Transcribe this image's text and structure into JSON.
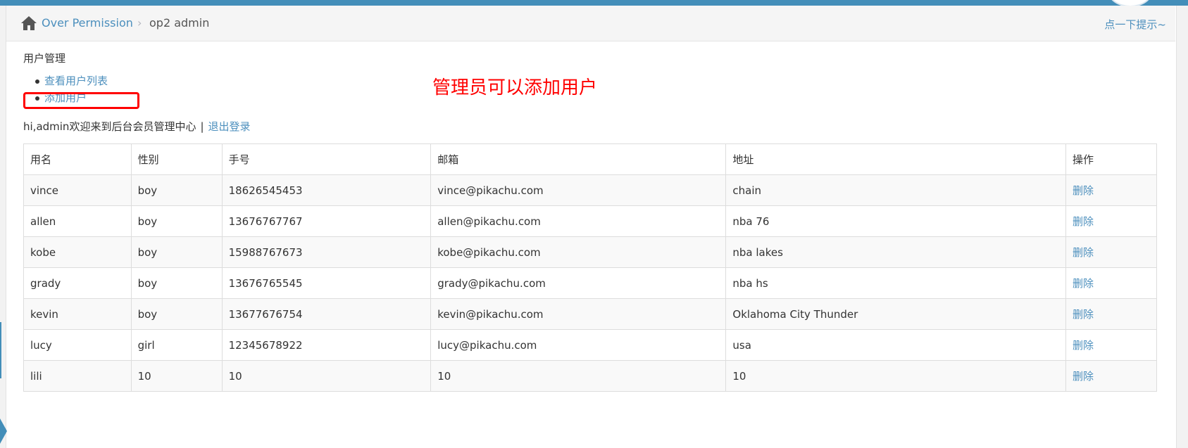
{
  "breadcrumb": {
    "home_icon": "home-icon",
    "parent": "Over Permission",
    "separator": "›",
    "current": "op2 admin"
  },
  "hint_link": "点一下提示~",
  "section_title": "用户管理",
  "menu": [
    {
      "label": "查看用户列表"
    },
    {
      "label": "添加用户"
    }
  ],
  "annotation": "管理员可以添加用户",
  "welcome": {
    "text": "hi,admin欢迎来到后台会员管理中心",
    "separator": "|",
    "logout": "退出登录"
  },
  "table": {
    "headers": [
      "用名",
      "性别",
      "手号",
      "邮箱",
      "地址",
      "操作"
    ],
    "rows": [
      {
        "name": "vince",
        "sex": "boy",
        "phone": "18626545453",
        "email": "vince@pikachu.com",
        "address": "chain",
        "action": "删除"
      },
      {
        "name": "allen",
        "sex": "boy",
        "phone": "13676767767",
        "email": "allen@pikachu.com",
        "address": "nba 76",
        "action": "删除"
      },
      {
        "name": "kobe",
        "sex": "boy",
        "phone": "15988767673",
        "email": "kobe@pikachu.com",
        "address": "nba lakes",
        "action": "删除"
      },
      {
        "name": "grady",
        "sex": "boy",
        "phone": "13676765545",
        "email": "grady@pikachu.com",
        "address": "nba hs",
        "action": "删除"
      },
      {
        "name": "kevin",
        "sex": "boy",
        "phone": "13677676754",
        "email": "kevin@pikachu.com",
        "address": "Oklahoma City Thunder",
        "action": "删除"
      },
      {
        "name": "lucy",
        "sex": "girl",
        "phone": "12345678922",
        "email": "lucy@pikachu.com",
        "address": "usa",
        "action": "删除"
      },
      {
        "name": "lili",
        "sex": "10",
        "phone": "10",
        "email": "10",
        "address": "10",
        "action": "删除"
      }
    ]
  },
  "colors": {
    "accent": "#438eb9",
    "link": "#4c8fbd",
    "annotation": "#ff0000"
  }
}
